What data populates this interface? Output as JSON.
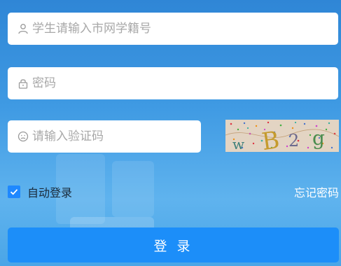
{
  "form": {
    "student_id": {
      "placeholder": "学生请输入市网学籍号",
      "value": ""
    },
    "password": {
      "placeholder": "密码",
      "value": ""
    },
    "captcha": {
      "placeholder": "请输入验证码",
      "value": ""
    },
    "captcha_image": {
      "text": "wB2g"
    },
    "remember_label": "自动登录",
    "remember_checked": true,
    "forgot_label": "忘记密码",
    "login_label": "登 录"
  },
  "colors": {
    "primary": "#1c8ef9",
    "checkbox": "#1e88ff",
    "background_top": "#2f86d6",
    "background_bottom": "#5fb3ee"
  },
  "icons": {
    "student": "user-icon",
    "password": "lock-icon",
    "captcha": "smiley-icon",
    "checkbox": "checkmark-icon"
  }
}
